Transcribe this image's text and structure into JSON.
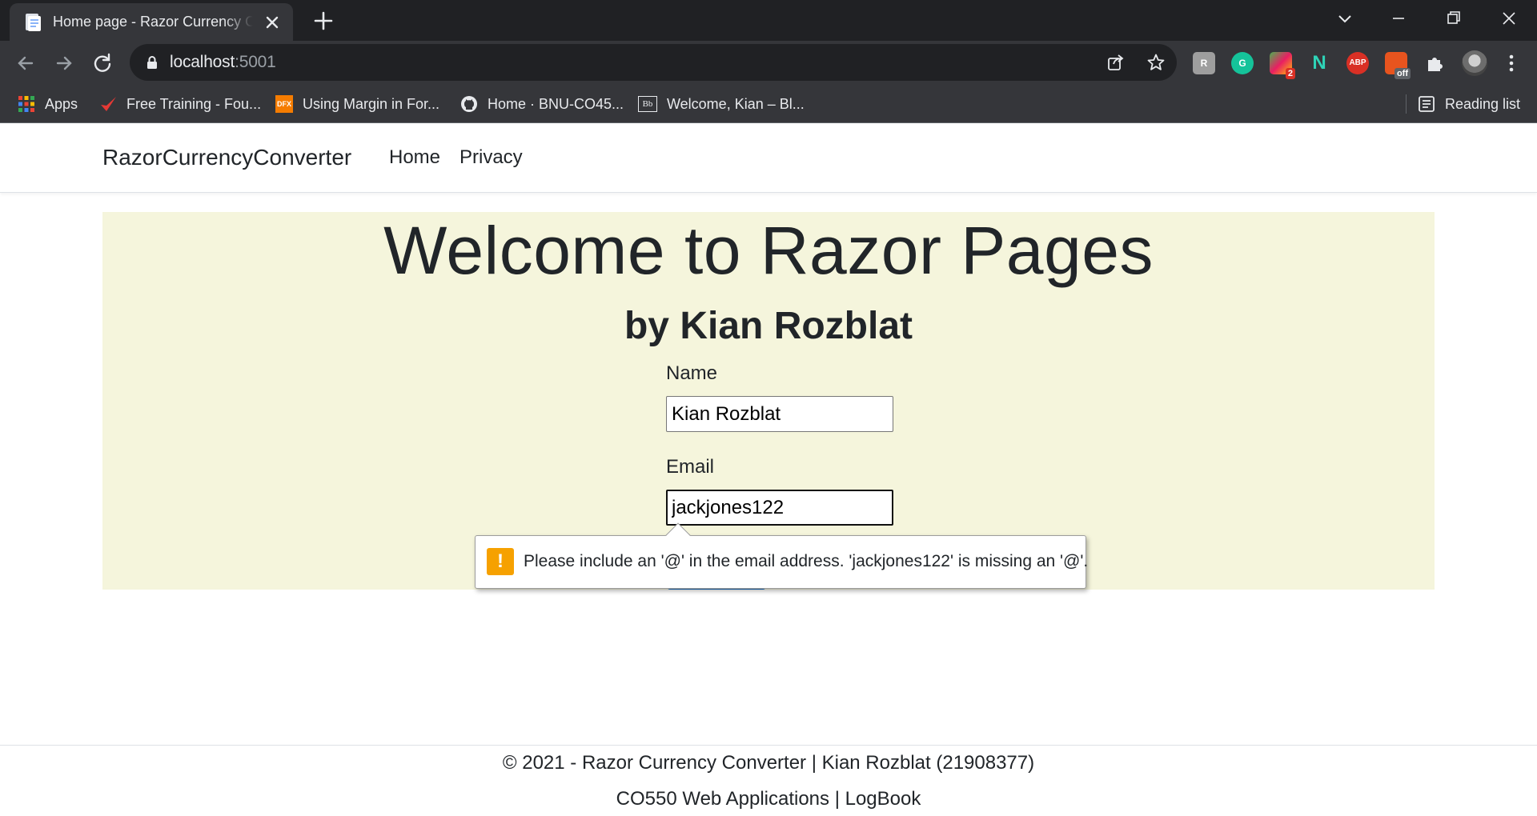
{
  "browser": {
    "tab_title": "Home page - Razor Currency Converter",
    "url_host": "localhost",
    "url_port": ":5001",
    "extensions": [
      {
        "name": "extension-icon",
        "text": "R"
      },
      {
        "name": "grammarly-icon",
        "text": "G"
      },
      {
        "name": "extension-badge-icon",
        "text": "2"
      },
      {
        "name": "extension-n-icon",
        "text": "N"
      },
      {
        "name": "adblock-plus-icon",
        "text": "ABP"
      },
      {
        "name": "coupon-extension-icon",
        "text": "off"
      }
    ],
    "bookmarks": [
      {
        "name": "bookmark-apps",
        "label": "Apps"
      },
      {
        "name": "bookmark-free-training",
        "label": "Free Training - Fou..."
      },
      {
        "name": "bookmark-using-margin",
        "label": "Using Margin in For..."
      },
      {
        "name": "bookmark-github-home",
        "label": "Home · BNU-CO45..."
      },
      {
        "name": "bookmark-welcome-kian",
        "label": "Welcome, Kian – Bl..."
      }
    ],
    "reading_list": "Reading list"
  },
  "navbar": {
    "brand": "RazorCurrencyConverter",
    "links": [
      "Home",
      "Privacy"
    ]
  },
  "main": {
    "heading": "Welcome to Razor Pages",
    "subheading": "by Kian Rozblat",
    "form": {
      "name_label": "Name",
      "name_value": "Kian Rozblat",
      "email_label": "Email",
      "email_value": "jackjones122"
    },
    "validation": {
      "icon": "!",
      "message": "Please include an '@' in the email address. 'jackjones122' is missing an '@'."
    }
  },
  "footer": {
    "line1": "© 2021 - Razor Currency Converter | Kian Rozblat (21908377)",
    "line2": "CO550 Web Applications | LogBook"
  }
}
